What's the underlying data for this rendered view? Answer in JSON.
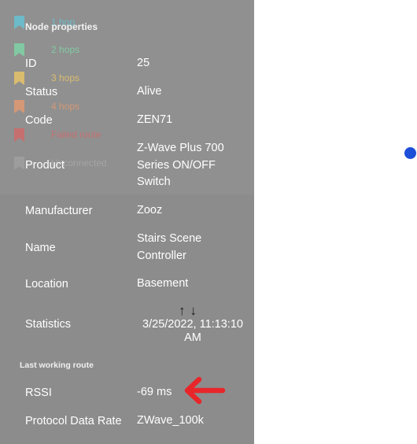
{
  "legend": [
    {
      "label": "1 hop",
      "color": "#67c2d4"
    },
    {
      "label": "2 hops",
      "color": "#7fd4a6"
    },
    {
      "label": "3 hops",
      "color": "#e8c46a"
    },
    {
      "label": "4 hops",
      "color": "#e09a72"
    },
    {
      "label": "Failed route",
      "color": "#d06a6a"
    },
    {
      "label": "Unconnected",
      "color": "#a0a0a0"
    }
  ],
  "section_title": "Node properties",
  "properties": [
    {
      "label": "ID",
      "value": "25"
    },
    {
      "label": "Status",
      "value": "Alive"
    },
    {
      "label": "Code",
      "value": "ZEN71"
    },
    {
      "label": "Product",
      "value": "Z-Wave Plus 700 Series ON/OFF Switch"
    },
    {
      "label": "Manufacturer",
      "value": "Zooz"
    },
    {
      "label": "Name",
      "value": "Stairs Scene Controller"
    },
    {
      "label": "Location",
      "value": "Basement"
    },
    {
      "label": "Statistics",
      "value": "3/25/2022, 11:13:10 AM"
    }
  ],
  "sort_icons": "↑↓",
  "route_title": "Last working route",
  "route_properties": [
    {
      "label": "RSSI",
      "value": "-69 ms"
    },
    {
      "label": "Protocol Data Rate",
      "value": "ZWave_100k"
    }
  ],
  "colors": {
    "panel": "#8c8c8c",
    "node_dot": "#1c4fd8",
    "annotation_arrow": "#e8262a"
  }
}
